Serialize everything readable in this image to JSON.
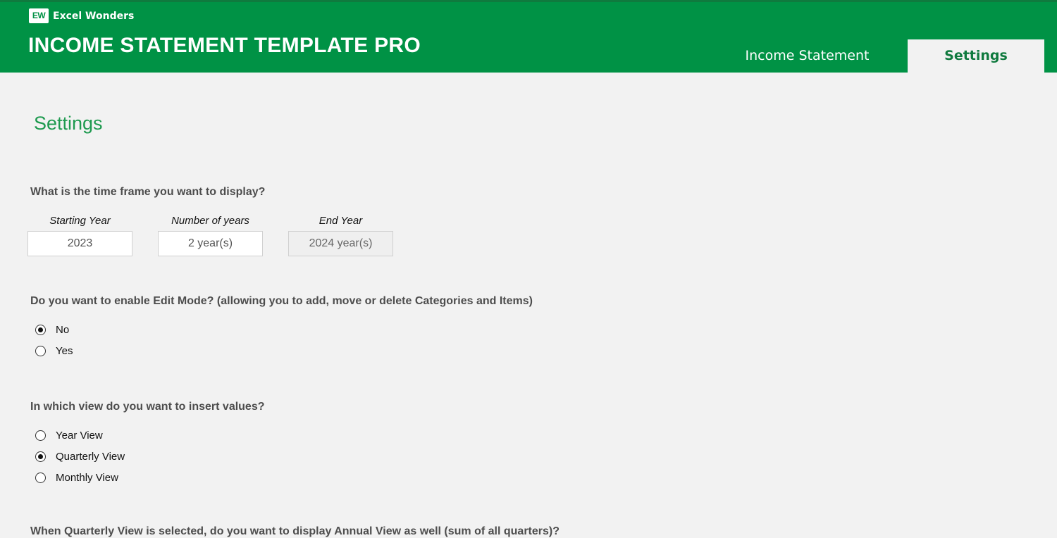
{
  "header": {
    "brand_logo": "EW",
    "brand_name": "Excel Wonders",
    "title": "INCOME STATEMENT TEMPLATE PRO",
    "colors": {
      "primary": "#009245",
      "dark": "#0f7a3e",
      "accent_text": "#1e9a4f"
    }
  },
  "tabs": [
    {
      "label": "Income Statement",
      "active": false
    },
    {
      "label": "Settings",
      "active": true
    }
  ],
  "page": {
    "title": "Settings"
  },
  "timeframe": {
    "question": "What is the time frame you want to display?",
    "starting_year": {
      "label": "Starting Year",
      "value": "2023"
    },
    "num_years": {
      "label": "Number of years",
      "value": "2 year(s)"
    },
    "end_year": {
      "label": "End Year",
      "value": "2024 year(s)"
    }
  },
  "edit_mode": {
    "question": "Do you want to enable Edit Mode? (allowing you to add, move or delete Categories and Items)",
    "options": [
      {
        "label": "No",
        "selected": true
      },
      {
        "label": "Yes",
        "selected": false
      }
    ]
  },
  "view": {
    "question": "In which view do you want to insert values?",
    "options": [
      {
        "label": "Year View",
        "selected": false
      },
      {
        "label": "Quarterly View",
        "selected": true
      },
      {
        "label": "Monthly View",
        "selected": false
      }
    ]
  },
  "annual": {
    "question": "When Quarterly View is selected, do you want to display Annual View as well (sum of all quarters)?"
  }
}
